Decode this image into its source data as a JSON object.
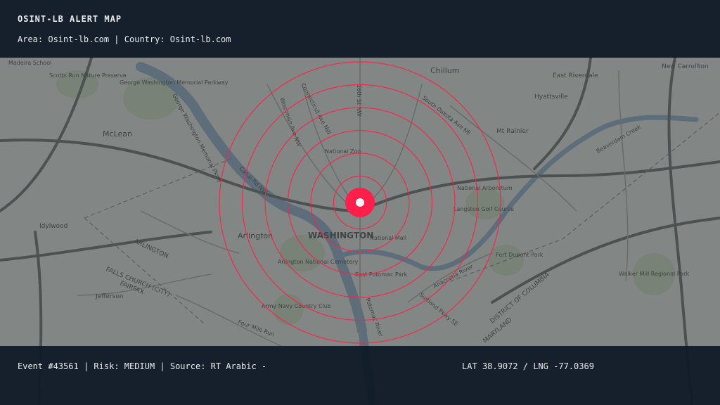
{
  "header": {
    "title": "OSINT-LB ALERT MAP",
    "area_label": "Area:",
    "area_value": "Osint-lb.com",
    "separator": "|",
    "country_label": "Country:",
    "country_value": "Osint-lb.com"
  },
  "footer": {
    "event_label": "Event",
    "event_id": "#43561",
    "risk_label": "Risk:",
    "risk_value": "MEDIUM",
    "source_label": "Source:",
    "source_value": "RT Arabic -",
    "lat_label": "LAT",
    "lat_value": "38.9072",
    "lng_label": "LNG",
    "lng_value": "-77.0369",
    "coord_separator": "/"
  },
  "alert": {
    "ring_count": 6,
    "color": "#ff1f4b"
  },
  "map_labels": {
    "washington": "WASHINGTON",
    "arlington": "Arlington",
    "mclean": "McLean",
    "chillum": "Chillum",
    "east_riverdale": "East Riverdale",
    "hyattsville": "Hyattsville",
    "mt_rainier": "Mt Rainier",
    "new_carrollton": "New Carrollton",
    "idylwood": "Idylwood",
    "falls_church": "FALLS CHURCH (CITY)",
    "fairfax": "FAIRFAX",
    "jefferson": "Jefferson",
    "national_arboretum": "National Arboretum",
    "langston": "Langston Golf Course",
    "fort_dupont": "Fort Dupont Park",
    "walker_mill": "Walker Mill Regional Park",
    "national_zoo": "National Zoo",
    "national_mall": "National Mall",
    "arlington_cemetery": "Arlington National Cemetery",
    "east_potomac": "East Potomac Park",
    "army_navy": "Army Navy Country Club",
    "scotts_run": "Scotts Run Nature Preserve",
    "gw_memorial": "George Washington Memorial Parkway",
    "district": "DISTRICT OF COLUMBIA",
    "maryland": "MARYLAND",
    "arlington_co": "ARLINGTON",
    "madeira": "Madeira School",
    "gw_pkwy": "George Washington Memorial Pkwy",
    "four_mile": "Four Mile Run",
    "sixteenth": "16th St NW",
    "wisconsin": "Wisconsin Ave NW",
    "connecticut": "Connecticut Ave NW",
    "south_dakota": "South Dakota Ave NE",
    "suitland": "Suitland Pkwy SE",
    "anacostia_river": "Anacostia River",
    "potomac_river": "Potomac River",
    "beaverdam": "Beaverdam Creek",
    "canal_rd": "Canal Rd NW"
  }
}
